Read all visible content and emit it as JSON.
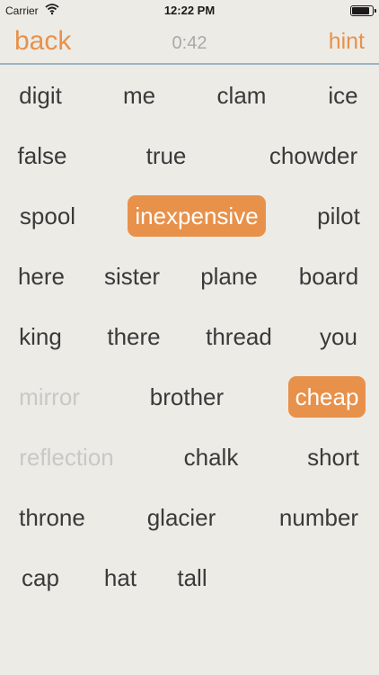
{
  "status_bar": {
    "carrier": "Carrier",
    "time": "12:22 PM",
    "battery_level": 0.9
  },
  "nav": {
    "back": "back",
    "timer": "0:42",
    "hint": "hint"
  },
  "accent_color": "#e8914a",
  "rows": [
    [
      {
        "text": "digit",
        "state": "normal"
      },
      {
        "text": "me",
        "state": "normal"
      },
      {
        "text": "clam",
        "state": "normal"
      },
      {
        "text": "ice",
        "state": "normal"
      }
    ],
    [
      {
        "text": "false",
        "state": "normal"
      },
      {
        "text": "true",
        "state": "normal"
      },
      {
        "text": "chowder",
        "state": "normal"
      }
    ],
    [
      {
        "text": "spool",
        "state": "normal"
      },
      {
        "text": "inexpensive",
        "state": "selected"
      },
      {
        "text": "pilot",
        "state": "normal"
      }
    ],
    [
      {
        "text": "here",
        "state": "normal"
      },
      {
        "text": "sister",
        "state": "normal"
      },
      {
        "text": "plane",
        "state": "normal"
      },
      {
        "text": "board",
        "state": "normal"
      }
    ],
    [
      {
        "text": "king",
        "state": "normal"
      },
      {
        "text": "there",
        "state": "normal"
      },
      {
        "text": "thread",
        "state": "normal"
      },
      {
        "text": "you",
        "state": "normal"
      }
    ],
    [
      {
        "text": "mirror",
        "state": "used"
      },
      {
        "text": "brother",
        "state": "normal"
      },
      {
        "text": "cheap",
        "state": "selected"
      }
    ],
    [
      {
        "text": "reflection",
        "state": "used"
      },
      {
        "text": "chalk",
        "state": "normal"
      },
      {
        "text": "short",
        "state": "normal"
      }
    ],
    [
      {
        "text": "throne",
        "state": "normal"
      },
      {
        "text": "glacier",
        "state": "normal"
      },
      {
        "text": "number",
        "state": "normal"
      }
    ],
    [
      {
        "text": "cap",
        "state": "normal"
      },
      {
        "text": "hat",
        "state": "normal"
      },
      {
        "text": "tall",
        "state": "normal"
      }
    ]
  ]
}
